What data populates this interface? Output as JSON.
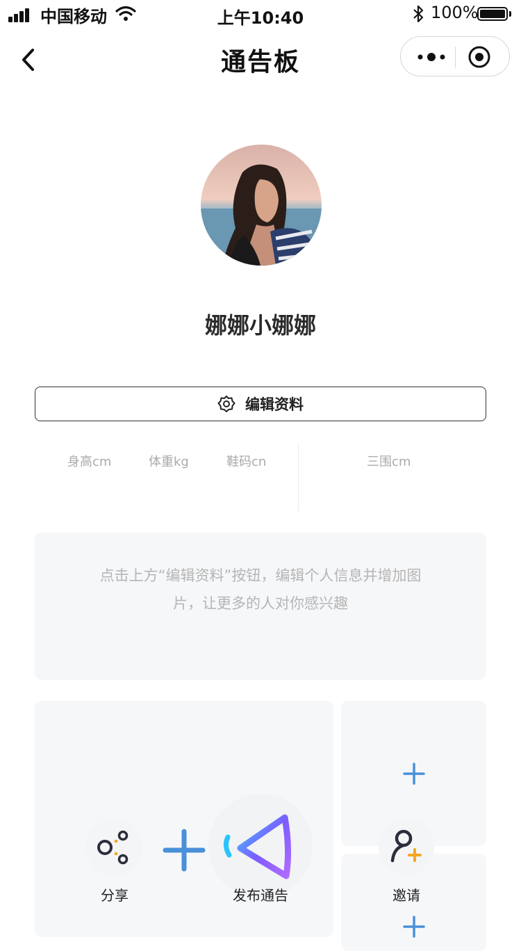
{
  "status_bar": {
    "carrier": "中国移动",
    "time": "上午10:40",
    "battery_percent": "100%",
    "battery_level": 1.0
  },
  "nav": {
    "title": "通告板",
    "back_icon": "chevron-left-icon",
    "more_icon": "more-dots-icon",
    "close_icon": "target-circle-icon"
  },
  "profile": {
    "username": "娜娜小娜娜",
    "edit_label": "编辑资料",
    "edit_icon": "gear-icon"
  },
  "stats": {
    "height_label": "身高cm",
    "weight_label": "体重kg",
    "shoe_label": "鞋码cn",
    "measurements_label": "三围cm"
  },
  "tip": {
    "text": "点击上方“编辑资料”按钮，编辑个人信息并增加图片，让更多的人对你感兴趣"
  },
  "actions": {
    "share_label": "分享",
    "publish_label": "发布通告",
    "invite_label": "邀请"
  },
  "colors": {
    "accent_blue": "#4a90d9",
    "accent_orange": "#f5a623",
    "card_bg": "#f6f7f9"
  }
}
